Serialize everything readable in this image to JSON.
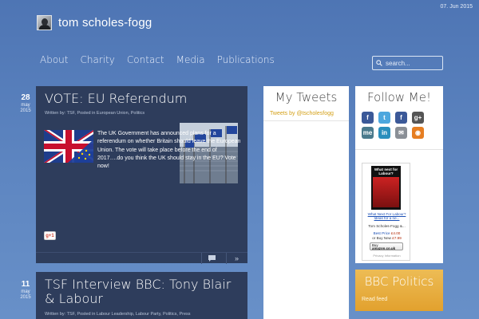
{
  "header": {
    "date": "07. Jun 2015",
    "site_title": "tom scholes-fogg"
  },
  "nav": {
    "items": [
      {
        "label": "About"
      },
      {
        "label": "Charity"
      },
      {
        "label": "Contact"
      },
      {
        "label": "Media"
      },
      {
        "label": "Publications"
      }
    ]
  },
  "search": {
    "placeholder": "search..."
  },
  "posts": [
    {
      "day": "28",
      "month": "may",
      "year": "2015",
      "title": "VOTE: EU Referendum",
      "meta": "Written by: TSF, Posted in European Union, Politics",
      "excerpt": "The UK Government has announced plans for a referendum on whether Britain should leave the European Union. The vote will take place before the end of 2017….do you think the UK should stay in the EU? Vote now!",
      "gplus_label": "g+1"
    },
    {
      "day": "11",
      "month": "may",
      "year": "2015",
      "title": "TSF Interview BBC: Tony Blair & Labour",
      "meta": "Written by: TSF, Posted in Labour Leadership, Labour Party, Politics, Press"
    }
  ],
  "tweets_widget": {
    "title": "My Tweets",
    "by_line": "Tweets by @tscholesfogg"
  },
  "follow_widget": {
    "title": "Follow Me!",
    "icons": [
      {
        "name": "facebook-icon",
        "glyph": "f",
        "color": "#3b5998"
      },
      {
        "name": "twitter-icon",
        "glyph": "t",
        "color": "#4da7de"
      },
      {
        "name": "facebook-icon",
        "glyph": "f",
        "color": "#3b5998"
      },
      {
        "name": "google-plus-icon",
        "glyph": "g+",
        "color": "#555555"
      },
      {
        "name": "myspace-icon",
        "glyph": "me",
        "color": "#4a7a8c"
      },
      {
        "name": "linkedin-icon",
        "glyph": "in",
        "color": "#2a8fbd"
      },
      {
        "name": "email-icon",
        "glyph": "✉",
        "color": "#8a8f96"
      },
      {
        "name": "rss-icon",
        "glyph": "◉",
        "color": "#e67e22"
      }
    ],
    "book": {
      "cover_title": "What next for Labour?",
      "title": "What Next For Labour? Ideas for a ne...",
      "author": "Tom Scholes-Fogg &...",
      "best_price_label": "Best Price",
      "best_price": "£4.00",
      "buy_new_label": "or Buy New",
      "buy_new_price": "£7.99",
      "buy_button_line1": "Buy",
      "buy_button_line2": "amazon.co.uk",
      "privacy": "Privacy Information"
    }
  },
  "bbc_widget": {
    "title": "BBC Politics",
    "read_link": "Read feed"
  },
  "colors": {
    "background": "#5b82bf",
    "post_background": "#2e3d5c",
    "accent_gold": "#e2a12e",
    "tweets_link": "#d4a017"
  }
}
